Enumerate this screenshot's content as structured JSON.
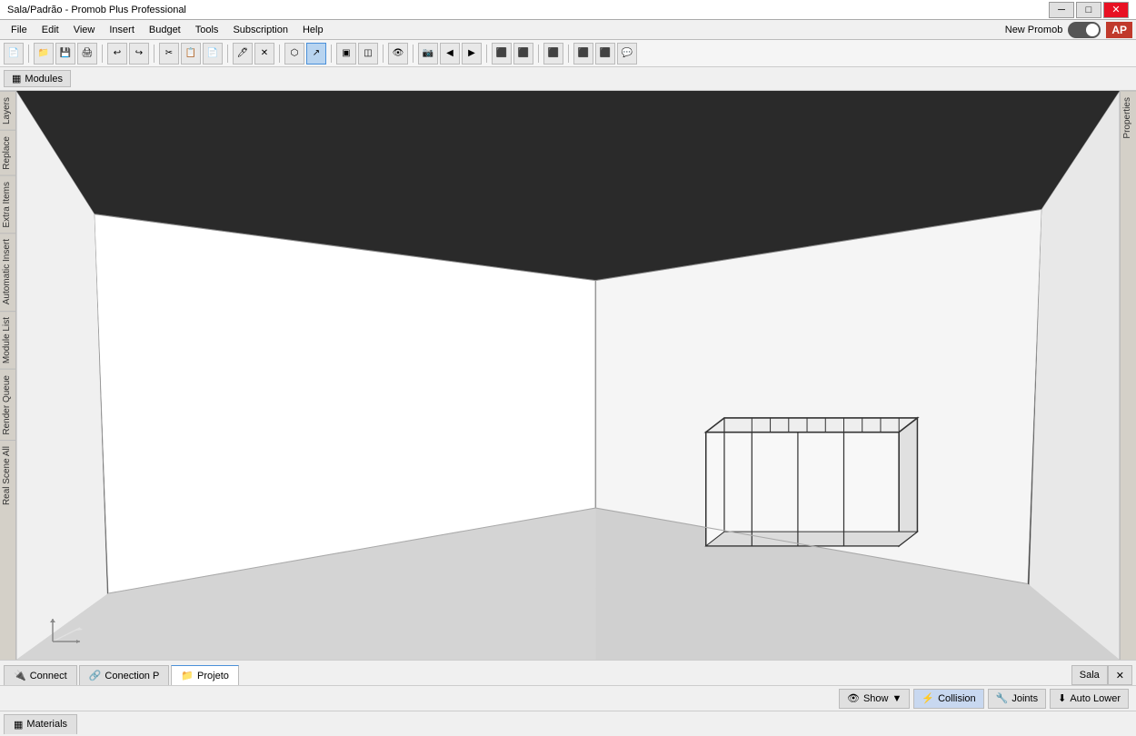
{
  "titlebar": {
    "title": "Sala/Padrão - Promob Plus Professional",
    "minimize": "─",
    "maximize": "□",
    "close": "✕"
  },
  "menubar": {
    "items": [
      "File",
      "Edit",
      "View",
      "Insert",
      "Budget",
      "Tools",
      "Subscription",
      "Help"
    ],
    "new_promob_label": "New Promob",
    "ap_label": "AP"
  },
  "toolbar": {
    "buttons": [
      "💾",
      "📁",
      "🖨",
      "↩",
      "↪",
      "✂",
      "📋",
      "📄",
      "🖊",
      "✕",
      "⬡",
      "⬡",
      "▣",
      "◫",
      "↗",
      "📐",
      "👁",
      "⚙",
      "◀",
      "▶",
      "⬛",
      "⬛",
      "⬛",
      "⬛",
      "⬛",
      "⬛",
      "⬛"
    ]
  },
  "modules_btn": "Modules",
  "sidebar_tabs": [
    "Layers",
    "Replace",
    "Extra Items",
    "Automatic Insert",
    "Module List",
    "Render Queue",
    "Real Scene All"
  ],
  "viewport": {
    "bg_color": "#3a3a3a",
    "room_color": "#ffffff",
    "floor_color": "#e8e8e8",
    "wall_color": "#ffffff",
    "ceiling_color": "#3a3a3a"
  },
  "right_sidebar_tabs": [
    "Properties"
  ],
  "bottom_tabs": [
    {
      "label": "Connect",
      "icon": "🔌",
      "active": false
    },
    {
      "label": "Conection P",
      "icon": "🔗",
      "active": false
    },
    {
      "label": "Projeto",
      "icon": "📁",
      "active": true
    }
  ],
  "statusbar": {
    "sala_btn": "Sala",
    "close_icon": "✕",
    "show_btn": "Show",
    "collision_btn": "Collision",
    "joints_btn": "Joints",
    "auto_lower_btn": "Auto Lower"
  },
  "materials_tab": "Materials"
}
